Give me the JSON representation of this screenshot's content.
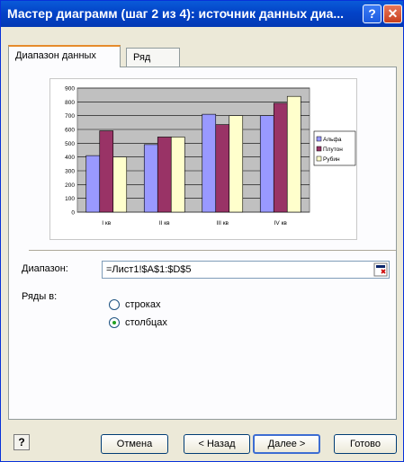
{
  "window": {
    "title": "Мастер диаграмм (шаг 2 из 4): источник данных диа...",
    "help_label": "?",
    "close_label": "✕"
  },
  "tabs": [
    {
      "label": "Диапазон данных",
      "active": true
    },
    {
      "label": "Ряд",
      "active": false
    }
  ],
  "chart_data": {
    "type": "bar",
    "categories": [
      "I кв",
      "II кв",
      "III кв",
      "IV кв"
    ],
    "series": [
      {
        "name": "Альфа",
        "color": "#9999ff",
        "values": [
          410,
          490,
          710,
          700
        ]
      },
      {
        "name": "Плутон",
        "color": "#993366",
        "values": [
          590,
          545,
          635,
          790
        ]
      },
      {
        "name": "Рубин",
        "color": "#ffffcc",
        "values": [
          400,
          545,
          700,
          840
        ]
      }
    ],
    "ylim": [
      0,
      900
    ],
    "yticks": [
      "0",
      "100",
      "200",
      "300",
      "400",
      "500",
      "600",
      "700",
      "800",
      "900"
    ],
    "grid": true,
    "legend_position": "right",
    "plot_background": "#c0c0c0"
  },
  "range": {
    "label": "Диапазон:",
    "value": "=Лист1!$A$1:$D$5"
  },
  "series_in": {
    "label": "Ряды в:",
    "options": [
      {
        "label": "строках",
        "checked": false
      },
      {
        "label": "столбцах",
        "checked": true
      }
    ]
  },
  "buttons": {
    "help": "?",
    "cancel": "Отмена",
    "back": "< Назад",
    "next": "Далее >",
    "done": "Готово"
  }
}
